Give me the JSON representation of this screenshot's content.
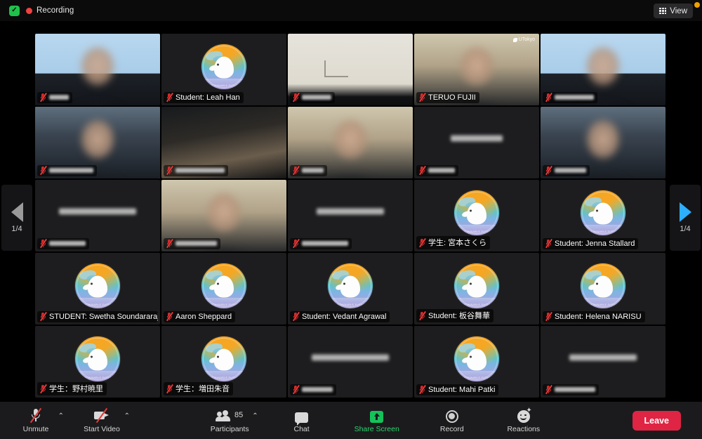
{
  "app": "zoom-meeting",
  "topbar": {
    "encryption_icon": "shield-check-icon",
    "recording_dot": "record-dot-icon",
    "recording_label": "Recording",
    "view_label": "View",
    "view_icon": "grid-view-icon"
  },
  "pager": {
    "left_icon": "chevron-left-page-icon",
    "right_icon": "chevron-right-page-icon",
    "left_counter": "1/4",
    "right_counter": "1/4"
  },
  "gallery": {
    "columns": 5,
    "rows": 5,
    "active_border_color": "#c8e64b",
    "tiles": [
      {
        "name": "",
        "redacted": true,
        "kind": "video-person",
        "muted": true,
        "active": false
      },
      {
        "name": "Student: Leah Han",
        "redacted": false,
        "kind": "avatar",
        "muted": true,
        "active": false
      },
      {
        "name": "",
        "redacted": true,
        "kind": "video-wall",
        "muted": true,
        "active": false
      },
      {
        "name": "TERUO FUJII",
        "redacted": false,
        "kind": "video-person",
        "muted": true,
        "active": false,
        "watermark": "UTokyo"
      },
      {
        "name": "",
        "redacted": true,
        "kind": "video-person",
        "muted": true,
        "active": false
      },
      {
        "name": "",
        "redacted": true,
        "kind": "video-person",
        "muted": true,
        "active": true
      },
      {
        "name": "",
        "redacted": true,
        "kind": "video-room",
        "muted": true,
        "active": false
      },
      {
        "name": "",
        "redacted": true,
        "kind": "video-person",
        "muted": true,
        "active": false
      },
      {
        "name": "",
        "redacted": true,
        "kind": "dark-name",
        "muted": true,
        "active": false
      },
      {
        "name": "",
        "redacted": true,
        "kind": "video-person",
        "muted": true,
        "active": false
      },
      {
        "name": "",
        "redacted": true,
        "kind": "dark-name",
        "muted": true,
        "active": false
      },
      {
        "name": "",
        "redacted": true,
        "kind": "video-person",
        "muted": true,
        "active": false
      },
      {
        "name": "",
        "redacted": true,
        "kind": "dark-name",
        "muted": true,
        "active": false
      },
      {
        "name": "学生: 宮本さくら",
        "redacted": false,
        "kind": "avatar",
        "muted": true,
        "active": false
      },
      {
        "name": "Student: Jenna Stallard",
        "redacted": false,
        "kind": "avatar",
        "muted": true,
        "active": false
      },
      {
        "name": "STUDENT: Swetha Soundararajan",
        "redacted": false,
        "kind": "avatar",
        "muted": true,
        "active": false
      },
      {
        "name": "Aaron Sheppard",
        "redacted": false,
        "kind": "avatar",
        "muted": true,
        "active": false
      },
      {
        "name": "Student: Vedant Agrawal",
        "redacted": false,
        "kind": "avatar",
        "muted": true,
        "active": false
      },
      {
        "name": "Student: 板谷舞華",
        "redacted": false,
        "kind": "avatar",
        "muted": true,
        "active": false
      },
      {
        "name": "Student: Helena NARISU",
        "redacted": false,
        "kind": "avatar",
        "muted": true,
        "active": false
      },
      {
        "name": "学生：野村暁里",
        "redacted": false,
        "kind": "avatar",
        "muted": true,
        "active": false
      },
      {
        "name": "学生：増田朱音",
        "redacted": false,
        "kind": "avatar",
        "muted": true,
        "active": false
      },
      {
        "name": "",
        "redacted": true,
        "kind": "dark-name",
        "muted": true,
        "active": false
      },
      {
        "name": "Student: Mahi Patki",
        "redacted": false,
        "kind": "avatar",
        "muted": true,
        "active": false
      },
      {
        "name": "",
        "redacted": true,
        "kind": "dark-name",
        "muted": true,
        "active": false
      }
    ]
  },
  "toolbar": {
    "unmute_label": "Unmute",
    "unmute_icon": "mic-muted-icon",
    "start_video_label": "Start Video",
    "start_video_icon": "camera-off-icon",
    "participants_label": "Participants",
    "participants_icon": "participants-icon",
    "participants_count": "85",
    "chat_label": "Chat",
    "chat_icon": "chat-bubble-icon",
    "share_screen_label": "Share Screen",
    "share_screen_icon": "share-screen-icon",
    "record_label": "Record",
    "record_icon": "record-circle-icon",
    "reactions_label": "Reactions",
    "reactions_icon": "reactions-smiley-icon",
    "leave_label": "Leave",
    "caret_icon": "chevron-up-icon",
    "share_color": "#2fd36e",
    "leave_color": "#e02443"
  }
}
